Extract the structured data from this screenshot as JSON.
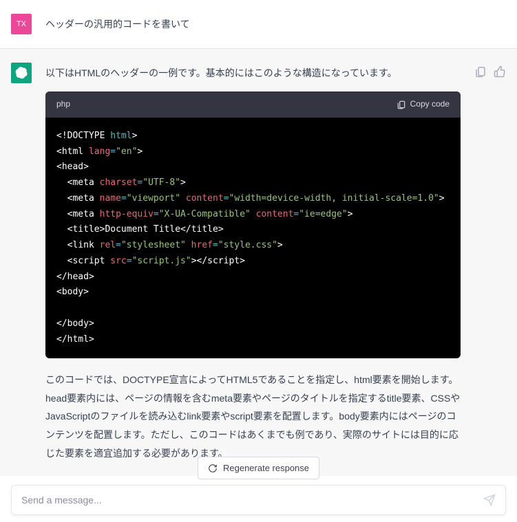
{
  "user": {
    "avatar": "TX",
    "message": "ヘッダーの汎用的コードを書いて"
  },
  "assistant": {
    "intro": "以下はHTMLのヘッダーの一例です。基本的にはこのような構造になっています。",
    "code_lang": "php",
    "copy_label": "Copy code",
    "explain": "このコードでは、DOCTYPE宣言によってHTML5であることを指定し、html要素を開始します。head要素内には、ページの情報を含むmeta要素やページのタイトルを指定するtitle要素、CSSやJavaScriptのファイルを読み込むlink要素やscript要素を配置します。body要素内にはページのコンテンツを配置します。ただし、このコードはあくまでも例であり、実際のサイトには目的に応じた要素を適宜追加する必要があります。"
  },
  "code": {
    "l1_a": "<!DOCTYPE",
    "l1_b": " html",
    "l1_c": ">",
    "l2_a": "<",
    "l2_b": "html",
    "l2_c": " lang",
    "l2_d": "=",
    "l2_e": "\"en\"",
    "l2_f": ">",
    "l3_a": "<",
    "l3_b": "head",
    "l3_c": ">",
    "l4_a": "  <",
    "l4_b": "meta",
    "l4_c": " charset",
    "l4_d": "=",
    "l4_e": "\"UTF-8\"",
    "l4_f": ">",
    "l5_a": "  <",
    "l5_b": "meta",
    "l5_c": " name",
    "l5_d": "=",
    "l5_e": "\"viewport\"",
    "l5_f": " content",
    "l5_g": "=",
    "l5_h": "\"width=device-width, initial-scale=1.0\"",
    "l5_i": ">",
    "l6_a": "  <",
    "l6_b": "meta",
    "l6_c": " http-equiv",
    "l6_d": "=",
    "l6_e": "\"X-UA-Compatible\"",
    "l6_f": " content",
    "l6_g": "=",
    "l6_h": "\"ie=edge\"",
    "l6_i": ">",
    "l7_a": "  <",
    "l7_b": "title",
    "l7_c": ">Document Title</",
    "l7_d": "title",
    "l7_e": ">",
    "l8_a": "  <",
    "l8_b": "link",
    "l8_c": " rel",
    "l8_d": "=",
    "l8_e": "\"stylesheet\"",
    "l8_f": " href",
    "l8_g": "=",
    "l8_h": "\"style.css\"",
    "l8_i": ">",
    "l9_a": "  <",
    "l9_b": "script",
    "l9_c": " src",
    "l9_d": "=",
    "l9_e": "\"script.js\"",
    "l9_f": "></",
    "l9_g": "script",
    "l9_h": ">",
    "l10_a": "</",
    "l10_b": "head",
    "l10_c": ">",
    "l11_a": "<",
    "l11_b": "body",
    "l11_c": ">",
    "l12": "",
    "l13_a": "</",
    "l13_b": "body",
    "l13_c": ">",
    "l14_a": "</",
    "l14_b": "html",
    "l14_c": ">"
  },
  "regen_label": "Regenerate response",
  "input_placeholder": "Send a message..."
}
